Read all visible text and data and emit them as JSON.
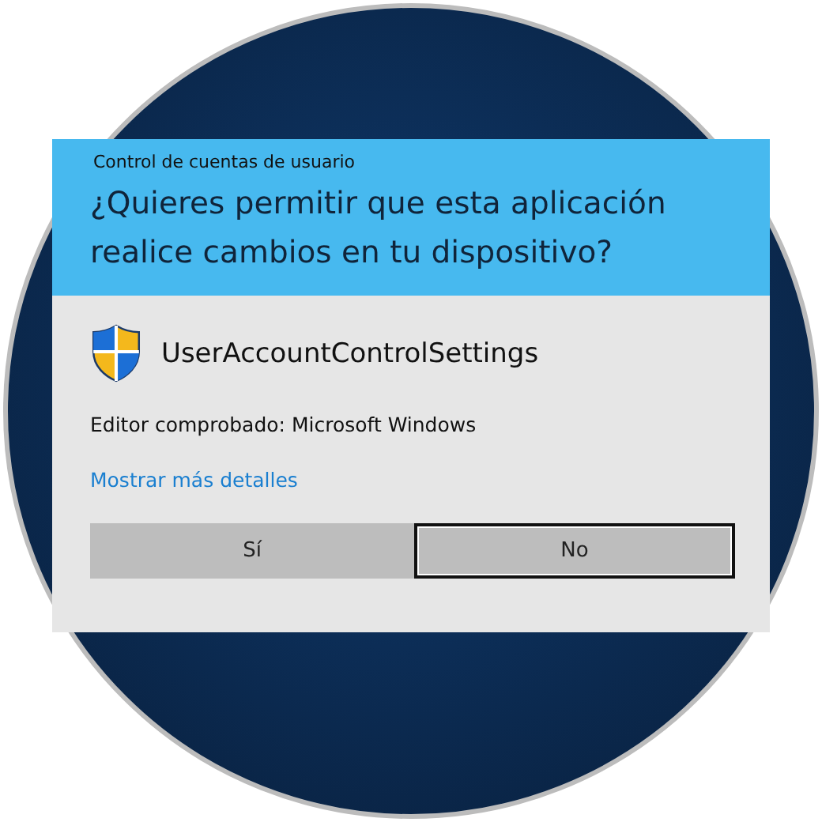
{
  "dialog": {
    "title": "Control de cuentas de usuario",
    "question": "¿Quieres permitir que esta aplicación realice cambios en tu dispositivo?",
    "app_name": "UserAccountControlSettings",
    "publisher": "Editor comprobado: Microsoft Windows",
    "details_link": "Mostrar más detalles",
    "buttons": [
      {
        "label": "Sí",
        "selected": false
      },
      {
        "label": "No",
        "selected": true
      }
    ]
  }
}
